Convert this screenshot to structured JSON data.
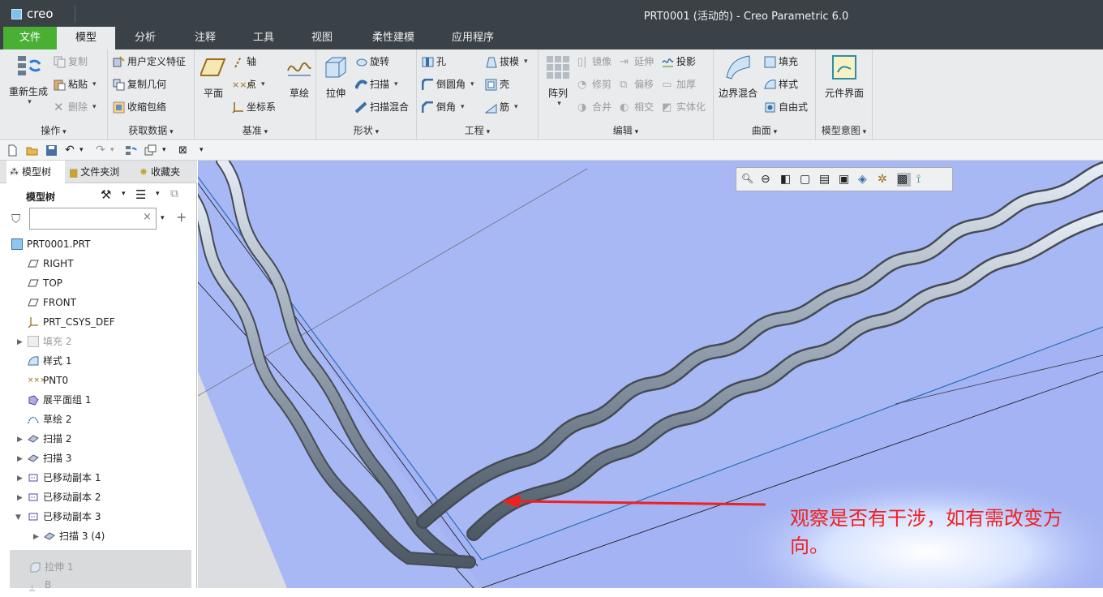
{
  "app": {
    "logo": "creo",
    "title": "PRT0001 (活动的) - Creo Parametric 6.0"
  },
  "tabs": [
    "文件",
    "模型",
    "分析",
    "注释",
    "工具",
    "视图",
    "柔性建模",
    "应用程序"
  ],
  "ribbon": {
    "op": {
      "regen": "重新生成",
      "copy": "复制",
      "paste": "粘贴",
      "delete": "删除",
      "label": "操作"
    },
    "getdata": {
      "udf": "用户定义特征",
      "copygeom": "复制几何",
      "shrink": "收缩包络",
      "label": "获取数据"
    },
    "datum": {
      "plane": "平面",
      "axis": "轴",
      "point": "点",
      "csys": "坐标系",
      "sketch": "草绘",
      "label": "基准"
    },
    "shape": {
      "extrude": "拉伸",
      "revolve": "旋转",
      "sweep": "扫描",
      "sweepblend": "扫描混合",
      "label": "形状"
    },
    "eng": {
      "hole": "孔",
      "round": "倒圆角",
      "chamfer": "倒角",
      "draft": "拔模",
      "shell": "壳",
      "rib": "筋",
      "label": "工程"
    },
    "edit": {
      "pattern": "阵列",
      "mirror": "镜像",
      "trim": "修剪",
      "merge": "合并",
      "extend": "延伸",
      "offset": "偏移",
      "intersect": "相交",
      "project": "投影",
      "thicken": "加厚",
      "solidify": "实体化",
      "label": "编辑"
    },
    "surface": {
      "boundary": "边界混合",
      "fill": "填充",
      "style": "样式",
      "freestyle": "自由式",
      "label": "曲面"
    },
    "intent": {
      "component": "元件界面",
      "label": "模型意图"
    }
  },
  "left": {
    "tabs": [
      "模型树",
      "文件夹浏",
      "收藏夹"
    ],
    "header": "模型树",
    "search": {
      "value": "",
      "placeholder": ""
    },
    "nodes": [
      "PRT0001.PRT",
      "RIGHT",
      "TOP",
      "FRONT",
      "PRT_CSYS_DEF",
      "填充 2",
      "样式 1",
      "PNT0",
      "展平面组 1",
      "草绘 2",
      "扫描 2",
      "扫描 3",
      "已移动副本 1",
      "已移动副本 2",
      "已移动副本 3",
      "扫描 3 (4)",
      "拉伸 1",
      "B"
    ]
  },
  "annotation": "观察是否有干涉，如有需改变方向。",
  "colors": {
    "titlebar": "#3b4247",
    "file_tab": "#4ab034",
    "viewport": "#a8b8f5",
    "note": "#f02020"
  }
}
